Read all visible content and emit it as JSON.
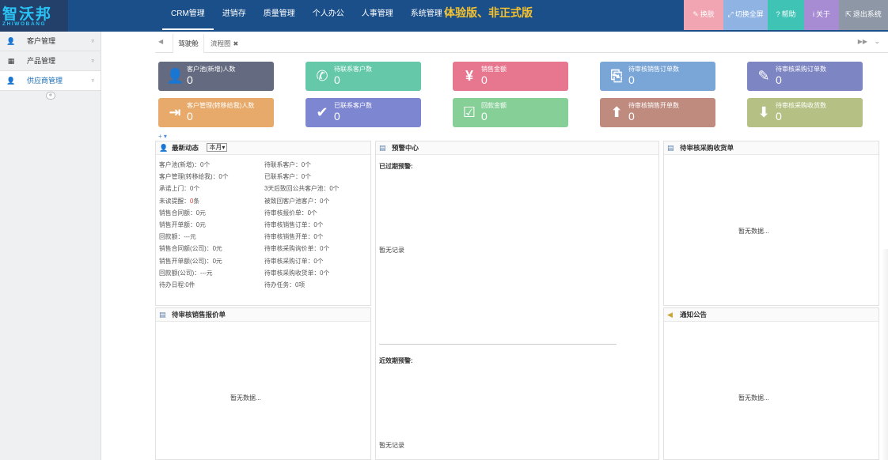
{
  "logo": {
    "main": "智沃邦",
    "sub": "ZHIWOBANG"
  },
  "nav": {
    "items": [
      {
        "label": "CRM管理"
      },
      {
        "label": "进销存"
      },
      {
        "label": "质量管理"
      },
      {
        "label": "个人办公"
      },
      {
        "label": "人事管理"
      },
      {
        "label": "系统管理",
        "arrow": "▾"
      }
    ],
    "banner": "体验版、非正式版"
  },
  "toolbar": [
    {
      "icon": "✎",
      "label": "换肤",
      "color": "#f1a4b1"
    },
    {
      "icon": "⤢",
      "label": "切换全屏",
      "color": "#8fb4e4"
    },
    {
      "icon": "?",
      "label": "帮助",
      "color": "#3fc3b4"
    },
    {
      "icon": "i",
      "label": "关于",
      "color": "#a78bd3"
    },
    {
      "icon": "⇱",
      "label": "退出系统",
      "color": "#8d97a6"
    }
  ],
  "sidebar": {
    "items": [
      {
        "icon": "👤",
        "label": "客户管理",
        "arrow": "▿"
      },
      {
        "icon": "▦",
        "label": "产品管理",
        "arrow": "▿"
      },
      {
        "icon": "👤",
        "label": "供应商管理",
        "arrow": "▿"
      }
    ],
    "collapse": "«"
  },
  "tabs": {
    "prev": "◀",
    "next": "▶▶",
    "menu": "⌄",
    "items": [
      {
        "label": "驾驶舱"
      },
      {
        "label": "流程图",
        "close": "✖"
      }
    ]
  },
  "cards": [
    {
      "label": "客户池(新增)人数",
      "value": "0",
      "icon": "👤",
      "color": "#646a80"
    },
    {
      "label": "待联系客户数",
      "value": "0",
      "icon": "✆",
      "color": "#64c8a9"
    },
    {
      "label": "销售金额",
      "value": "0",
      "icon": "¥",
      "color": "#e7778f"
    },
    {
      "label": "待审核销售订单数",
      "value": "0",
      "icon": "⎘",
      "color": "#7aa6d7"
    },
    {
      "label": "待审核采购订单数",
      "value": "0",
      "icon": "✎",
      "color": "#7d85c2"
    },
    {
      "label": "客户管理(转移给我)人数",
      "value": "0",
      "icon": "⇥",
      "color": "#e7aa6a"
    },
    {
      "label": "已联系客户数",
      "value": "0",
      "icon": "✔",
      "color": "#7d86d1"
    },
    {
      "label": "回款金额",
      "value": "0",
      "icon": "☑",
      "color": "#86cf97"
    },
    {
      "label": "待审核销售开单数",
      "value": "0",
      "icon": "⬆",
      "color": "#bf8b7f"
    },
    {
      "label": "待审核采购收货数",
      "value": "0",
      "icon": "⬇",
      "color": "#b5c184"
    }
  ],
  "addrow": "+ ▾",
  "news": {
    "title": "最新动态",
    "period": "本月",
    "period_arrow": "▾",
    "left": [
      {
        "label": "客户池(新增)：",
        "value": "0个"
      },
      {
        "label": "客户管理(转移给我)：",
        "value": "0个"
      },
      {
        "label": "承诺上门：",
        "value": "0个"
      },
      {
        "label": "未读提醒：",
        "value": "0",
        "unit": "条"
      },
      {
        "label": "销售合同额：",
        "value": "0元"
      },
      {
        "label": "销售开单额：",
        "value": "0元"
      },
      {
        "label": "回款额：",
        "value": "---元"
      },
      {
        "label": "销售合同额(公司)：",
        "value": "0元"
      },
      {
        "label": "销售开单额(公司)：",
        "value": "0元"
      },
      {
        "label": "回款额(公司)：",
        "value": "---元"
      },
      {
        "label": "待办日程:",
        "value": "0件"
      }
    ],
    "right": [
      {
        "label": "待联系客户：",
        "value": "0个"
      },
      {
        "label": "已联系客户：",
        "value": "0个"
      },
      {
        "label": "3天后致回公共客户池：",
        "value": "0个"
      },
      {
        "label": "被致回客户池客户：",
        "value": "0个"
      },
      {
        "label": "待审核报价单：",
        "value": "0个"
      },
      {
        "label": "待审核销售订单：",
        "value": "0个"
      },
      {
        "label": "待审核销售开单：",
        "value": "0个"
      },
      {
        "label": "待审核采购询价单：",
        "value": "0个"
      },
      {
        "label": "待审核采购订单：",
        "value": "0个"
      },
      {
        "label": "待审核采购收货单：",
        "value": "0个"
      },
      {
        "label": "待办任务：",
        "value": "0项"
      }
    ]
  },
  "warning": {
    "title": "预警中心",
    "expired_title": "已过期预警:",
    "expired_empty": "暂无记录",
    "near_title": "近效期预警:",
    "near_empty": "暂无记录"
  },
  "purchase_receipt": {
    "title": "待审核采购收货单",
    "empty": "暂无数据..."
  },
  "sales_quote": {
    "title": "待审核销售报价单",
    "empty": "暂无数据..."
  },
  "notice": {
    "title": "通知公告",
    "empty": "暂无数据..."
  }
}
